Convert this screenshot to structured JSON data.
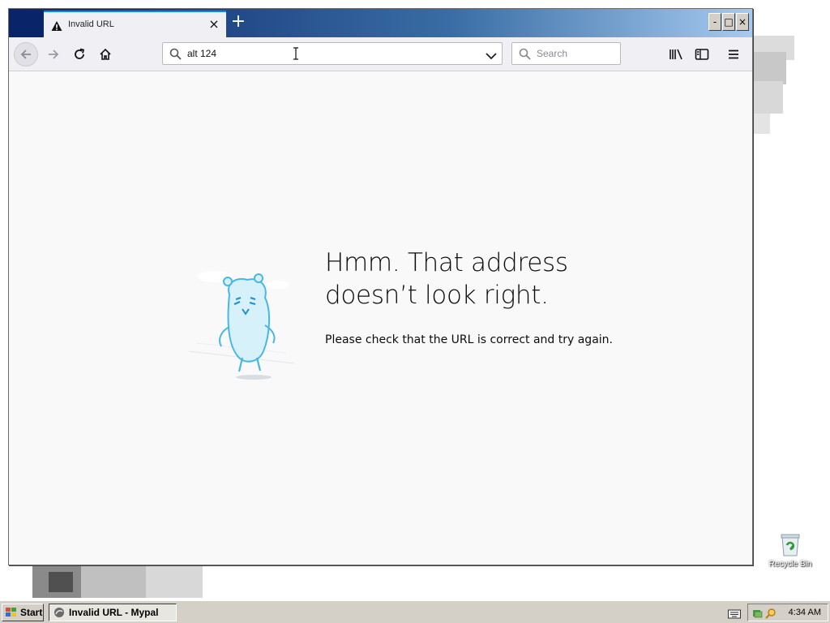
{
  "browser": {
    "tab": {
      "title": "Invalid URL",
      "close_label": "×"
    },
    "new_tab_label": "+",
    "window_buttons": {
      "minimize": "-",
      "maximize": "□",
      "close": "×"
    },
    "url_bar": {
      "value": "alt 124"
    },
    "search_box": {
      "placeholder": "Search"
    }
  },
  "error_page": {
    "heading_line1": "Hmm. That address",
    "heading_line2": "doesn’t look right.",
    "description": "Please check that the URL is correct and try again."
  },
  "desktop": {
    "recycle_bin_label": "Recycle Bin"
  },
  "taskbar": {
    "start_label": "Start",
    "active_task_label": "Invalid URL - Mypal",
    "clock": "4:34 AM"
  },
  "colors": {
    "accent": "#0a84ff",
    "titlebar_dark": "#0a246a",
    "page_background": "#f9f9fa",
    "taskbar": "#d4d0c8"
  }
}
